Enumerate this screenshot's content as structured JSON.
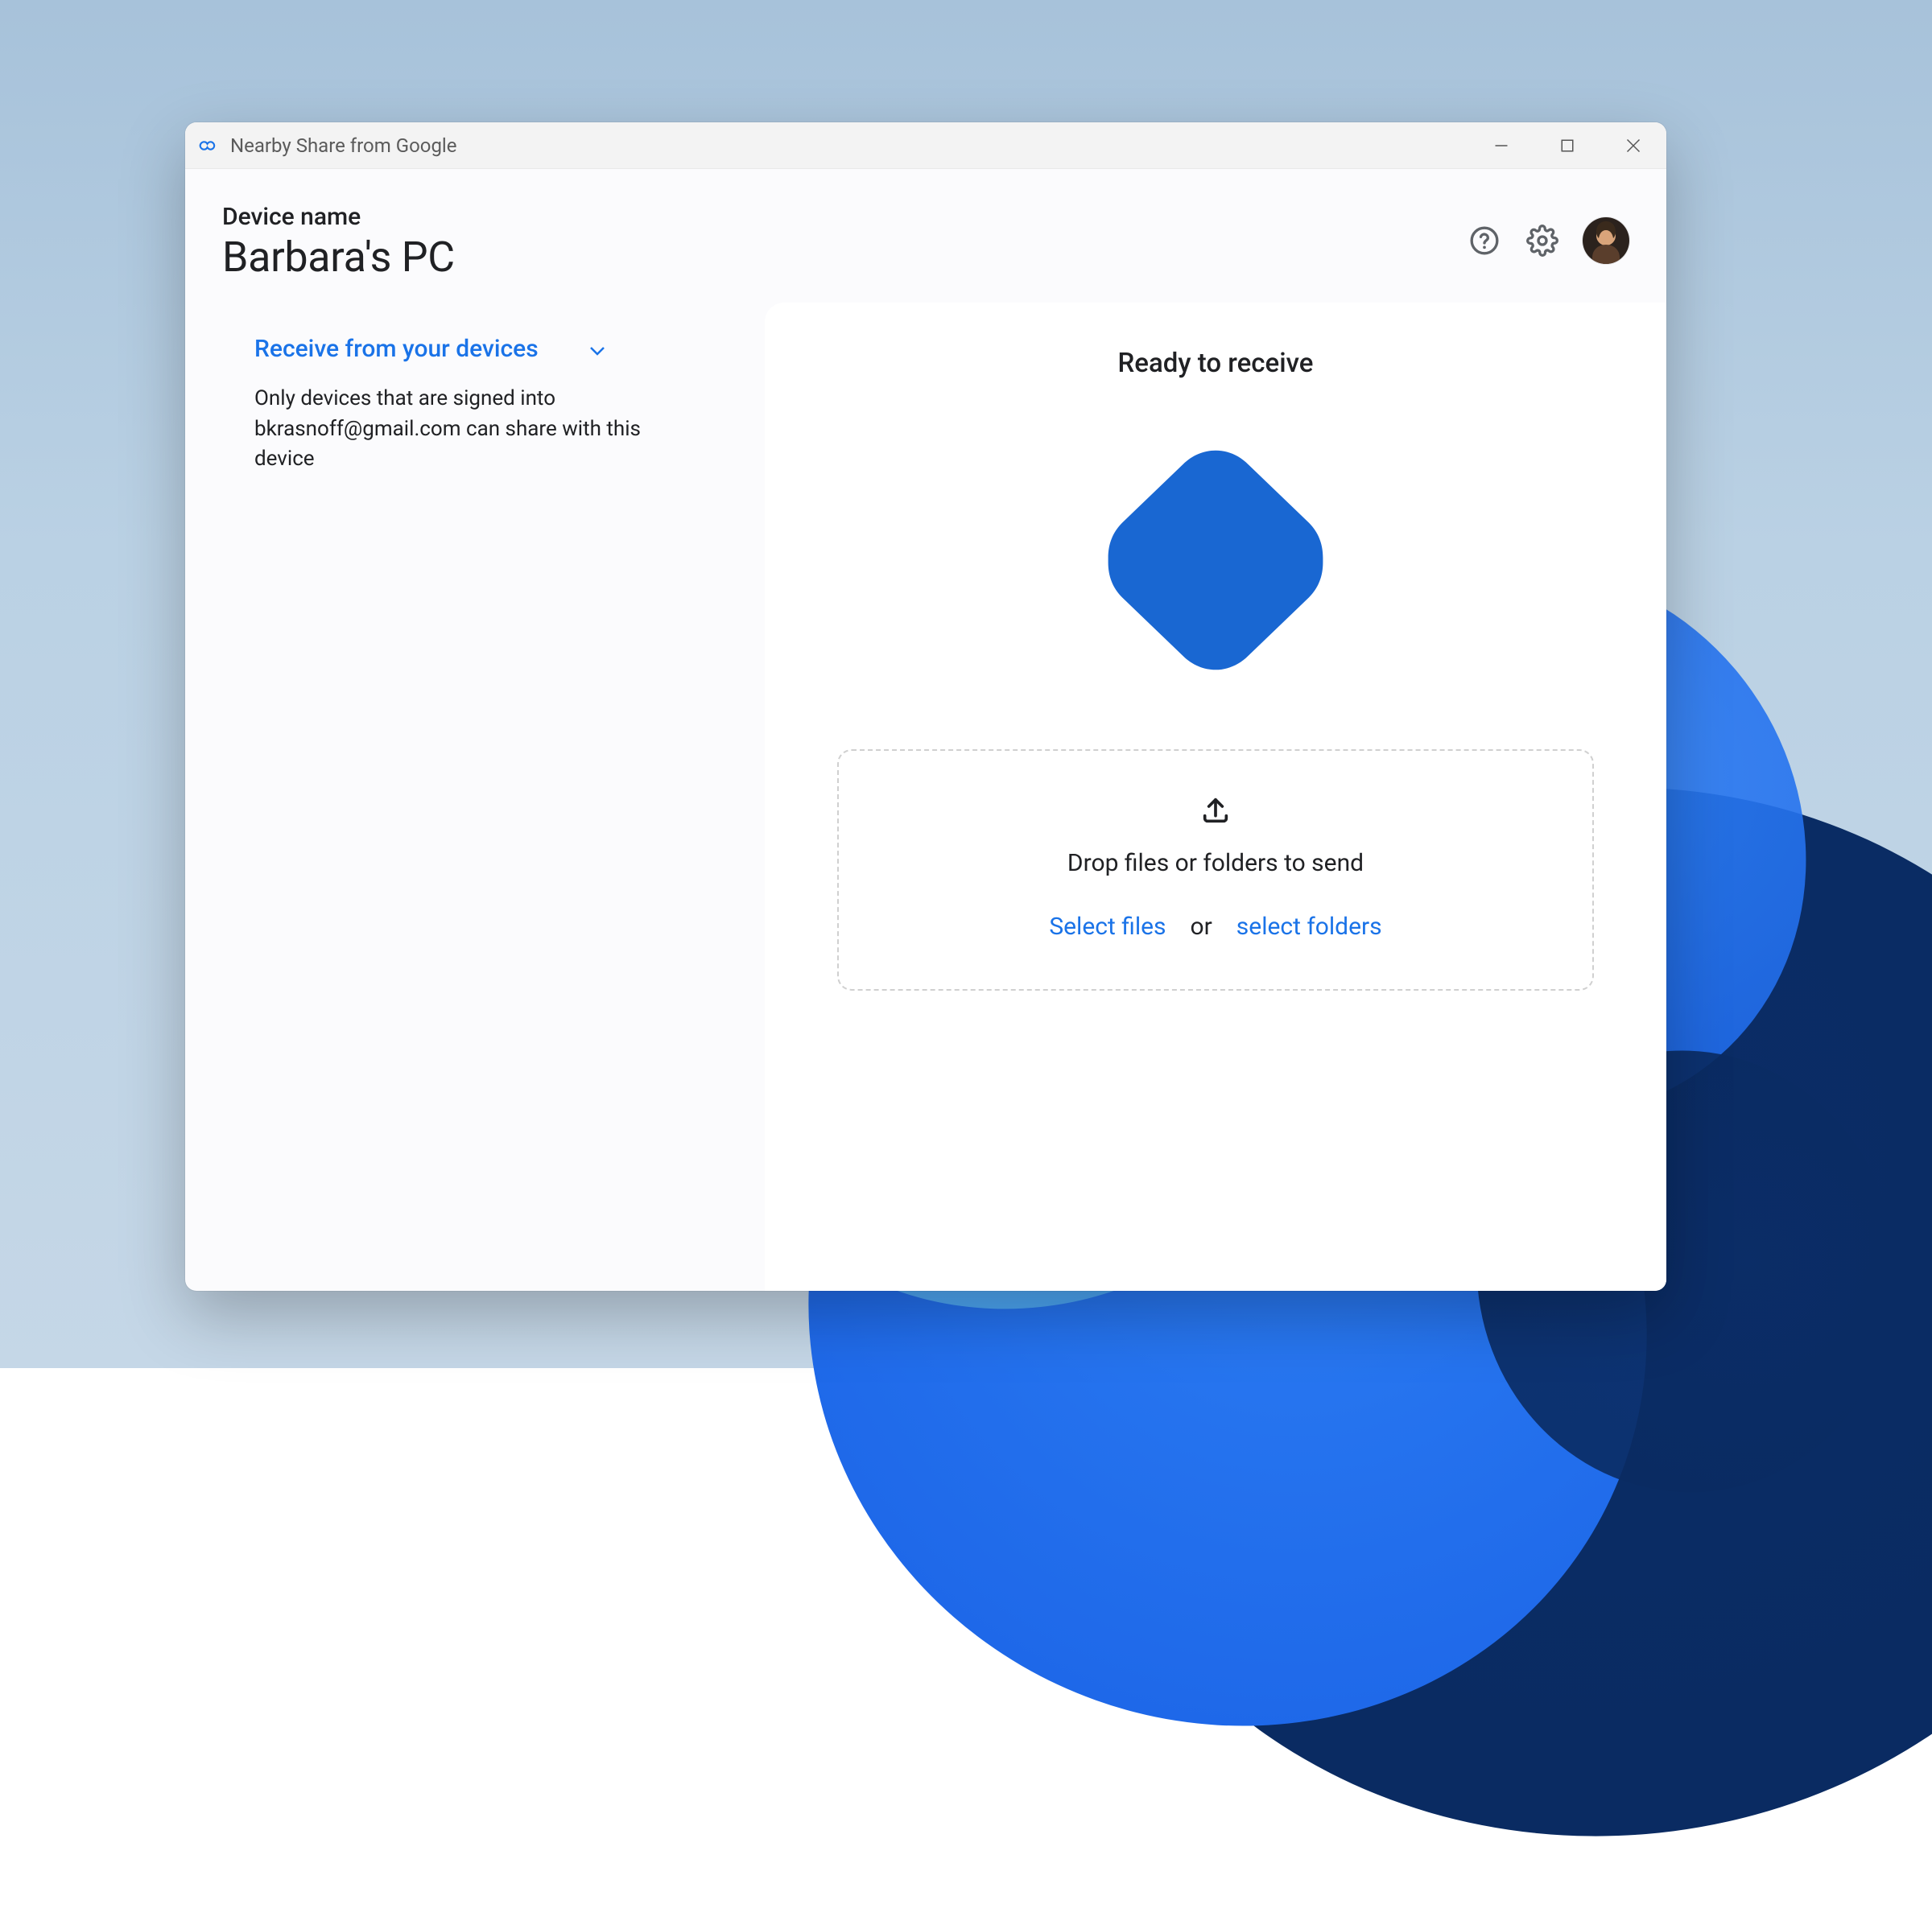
{
  "titlebar": {
    "title": "Nearby Share from Google"
  },
  "header": {
    "device_label": "Device name",
    "device_name": "Barbara's PC"
  },
  "side": {
    "receive_label": "Receive from your devices",
    "description": "Only devices that are signed into bkrasnoff@gmail.com can share with this device"
  },
  "panel": {
    "ready": "Ready to receive",
    "drop_text": "Drop files or folders to send",
    "select_files": "Select files",
    "or": "or",
    "select_folders": "select folders"
  },
  "colors": {
    "accent": "#1a73e8",
    "hex_fill": "#1967d2"
  }
}
